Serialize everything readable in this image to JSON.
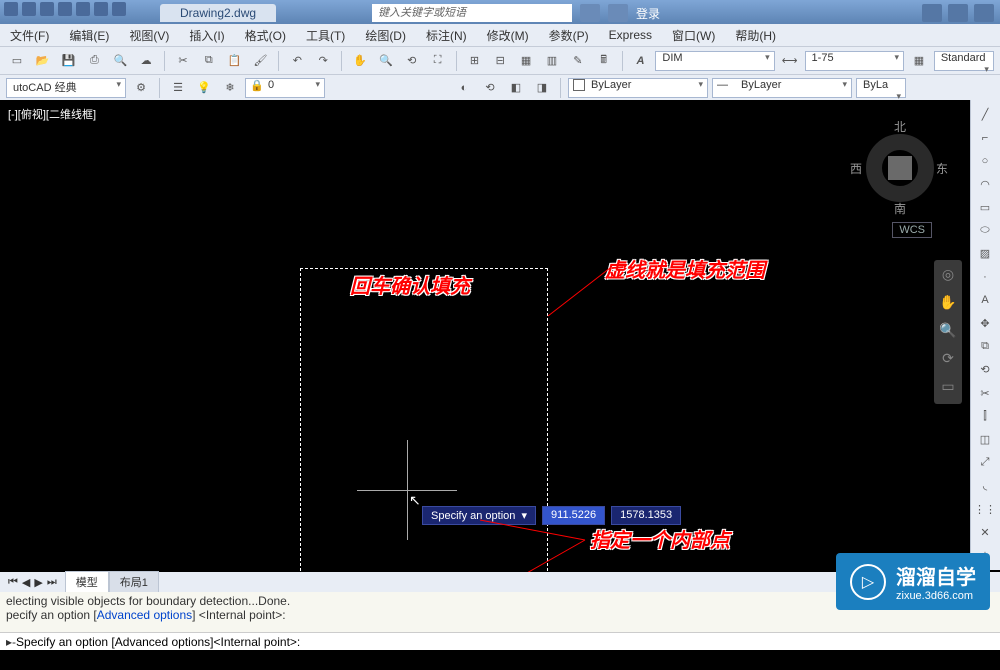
{
  "title_tab": "Drawing2.dwg",
  "search_placeholder": "键入关键字或短语",
  "login_text": "登录",
  "menu": [
    "文件(F)",
    "编辑(E)",
    "视图(V)",
    "插入(I)",
    "格式(O)",
    "工具(T)",
    "绘图(D)",
    "标注(N)",
    "修改(M)",
    "参数(P)",
    "Express",
    "窗口(W)",
    "帮助(H)"
  ],
  "combo_dimstyle": "DIM",
  "combo_scale": "1-75",
  "combo_textstyle": "Standard",
  "workspace": "utoCAD 经典",
  "layer_combo": "0",
  "bylayer1": "ByLayer",
  "bylayer2": "ByLayer",
  "bylayer3": "ByLa",
  "viewport_label": "[-][俯视][二维线框]",
  "compass": {
    "n": "北",
    "s": "南",
    "e": "东",
    "w": "西"
  },
  "wcs": "WCS",
  "dyn_prompt": "Specify an option",
  "dyn_x": "911.5226",
  "dyn_y": "1578.1353",
  "anno1": "回车确认填充",
  "anno2": "虚线就是填充范围",
  "anno3": "指定一个内部点",
  "tabs": {
    "model": "模型",
    "layout1": "布局1"
  },
  "cmd_history1": "electing visible objects for boundary detection...Done.",
  "cmd_history2_a": "pecify an option [",
  "cmd_history2_b": "Advanced options",
  "cmd_history2_c": "] <Internal point>:",
  "cmd_current_a": "Specify an option [",
  "cmd_current_adv": "Advanced options",
  "cmd_current_b": "] ",
  "cmd_current_hl": "<Internal point>:",
  "watermark": {
    "brand": "溜溜自学",
    "url": "zixue.3d66.com"
  }
}
